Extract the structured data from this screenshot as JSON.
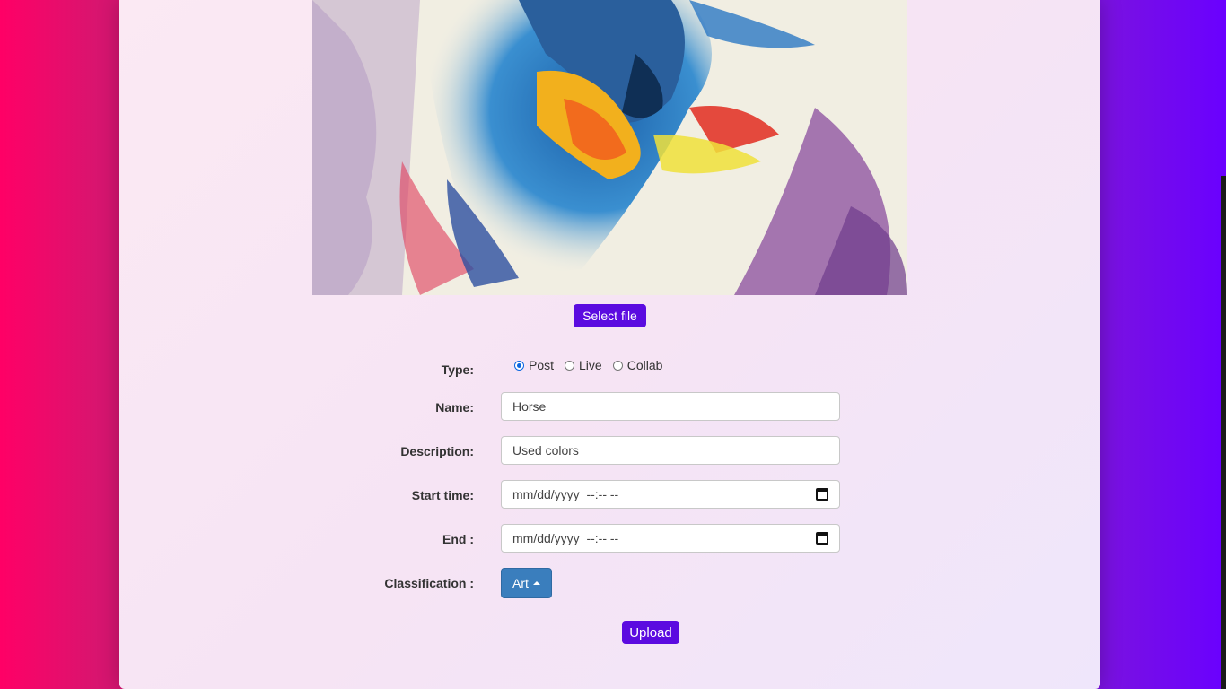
{
  "upload": {
    "select_file_label": "Select file",
    "upload_label": "Upload"
  },
  "form": {
    "type_label": "Type:",
    "type_options": [
      "Post",
      "Live",
      "Collab"
    ],
    "type_selected": "Post",
    "name_label": "Name:",
    "name_value": "Horse",
    "description_label": "Description:",
    "description_value": "Used colors",
    "start_label": "Start time:",
    "start_value": "mm/dd/yyyy  --:-- --",
    "end_label": "End :",
    "end_value": "mm/dd/yyyy  --:-- --",
    "classification_label": "Classification :",
    "classification_value": "Art"
  },
  "colors": {
    "accent_purple": "#5b0be0",
    "dropdown_blue": "#3a7ebd",
    "radio_blue": "#0a66e0"
  },
  "icons": [
    "calendar-icon",
    "caret-up-icon"
  ]
}
